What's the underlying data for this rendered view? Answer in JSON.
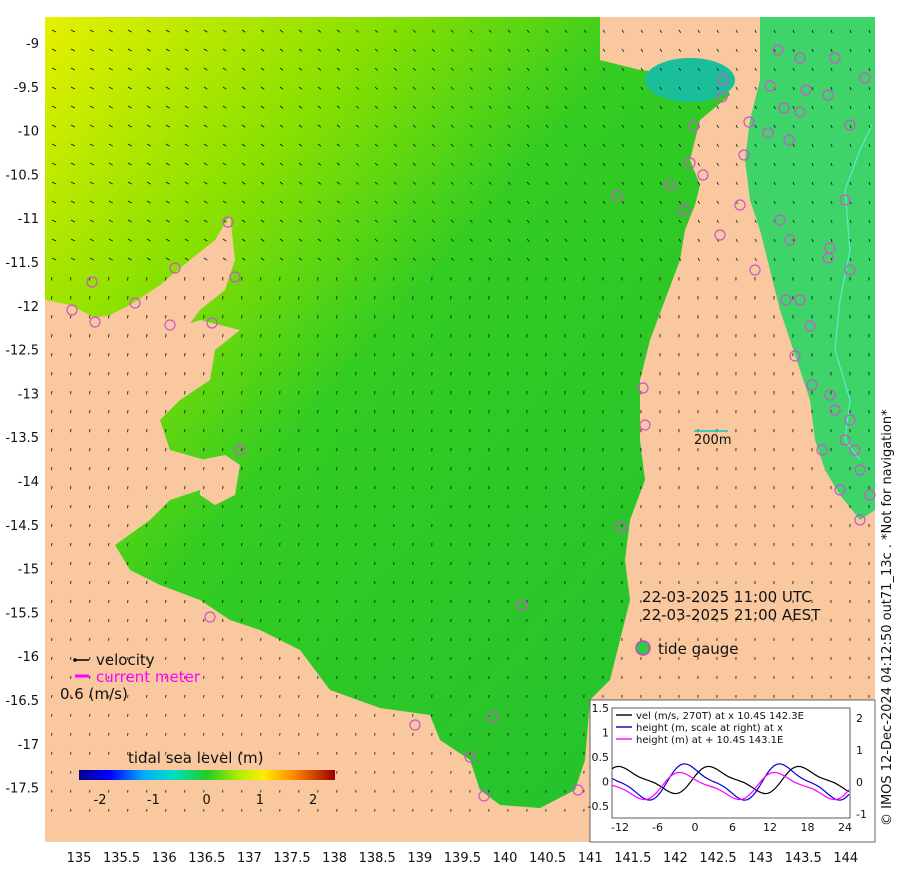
{
  "map": {
    "x_ticks": [
      "135",
      "135.5",
      "136",
      "136.5",
      "137",
      "137.5",
      "138",
      "138.5",
      "139",
      "139.5",
      "140",
      "140.5",
      "141",
      "141.5",
      "142",
      "142.5",
      "143",
      "143.5",
      "144"
    ],
    "y_ticks": [
      "-9",
      "-9.5",
      "-10",
      "-10.5",
      "-11",
      "-11.5",
      "-12",
      "-12.5",
      "-13",
      "-13.5",
      "-14",
      "-14.5",
      "-15",
      "-15.5",
      "-16",
      "-16.5",
      "-17",
      "-17.5"
    ],
    "scale_label": "200m",
    "timestamp_utc": "22-03-2025 11:00 UTC",
    "timestamp_aest": "22-03-2025 21:00 AEST",
    "tide_gauge_label": "tide gauge",
    "velocity_label": "velocity",
    "current_meter_label": "current meter",
    "velocity_scale": "0.6 (m/s)",
    "colorbar": {
      "title": "tidal sea level (m)",
      "ticks": [
        "-2",
        "-1",
        "0",
        "1",
        "2"
      ],
      "range": [
        -2.4,
        2.4
      ]
    },
    "copyright": "© IMOS 12-Dec-2024 04:12:50 out71_13c . *Not for navigation*",
    "colors": {
      "land": "#f9c89e",
      "sea": "#2ecc40",
      "gauge": "#cc44cc",
      "current_meter": "#ff00ff"
    }
  },
  "inset": {
    "legend": [
      "vel (m/s, 270T) at x 10.4S 142.3E",
      "height (m, scale at right) at x",
      "height (m) at + 10.4S 143.1E"
    ],
    "x_ticks": [
      "-12",
      "-6",
      "0",
      "6",
      "12",
      "18",
      "24"
    ],
    "y_left_ticks": [
      "1.5",
      "1",
      "0.5",
      "0",
      "-0.5"
    ],
    "y_right_ticks": [
      "2",
      "1",
      "0",
      "-1"
    ],
    "series_colors": [
      "#000000",
      "#0000cc",
      "#ff00ff"
    ]
  }
}
